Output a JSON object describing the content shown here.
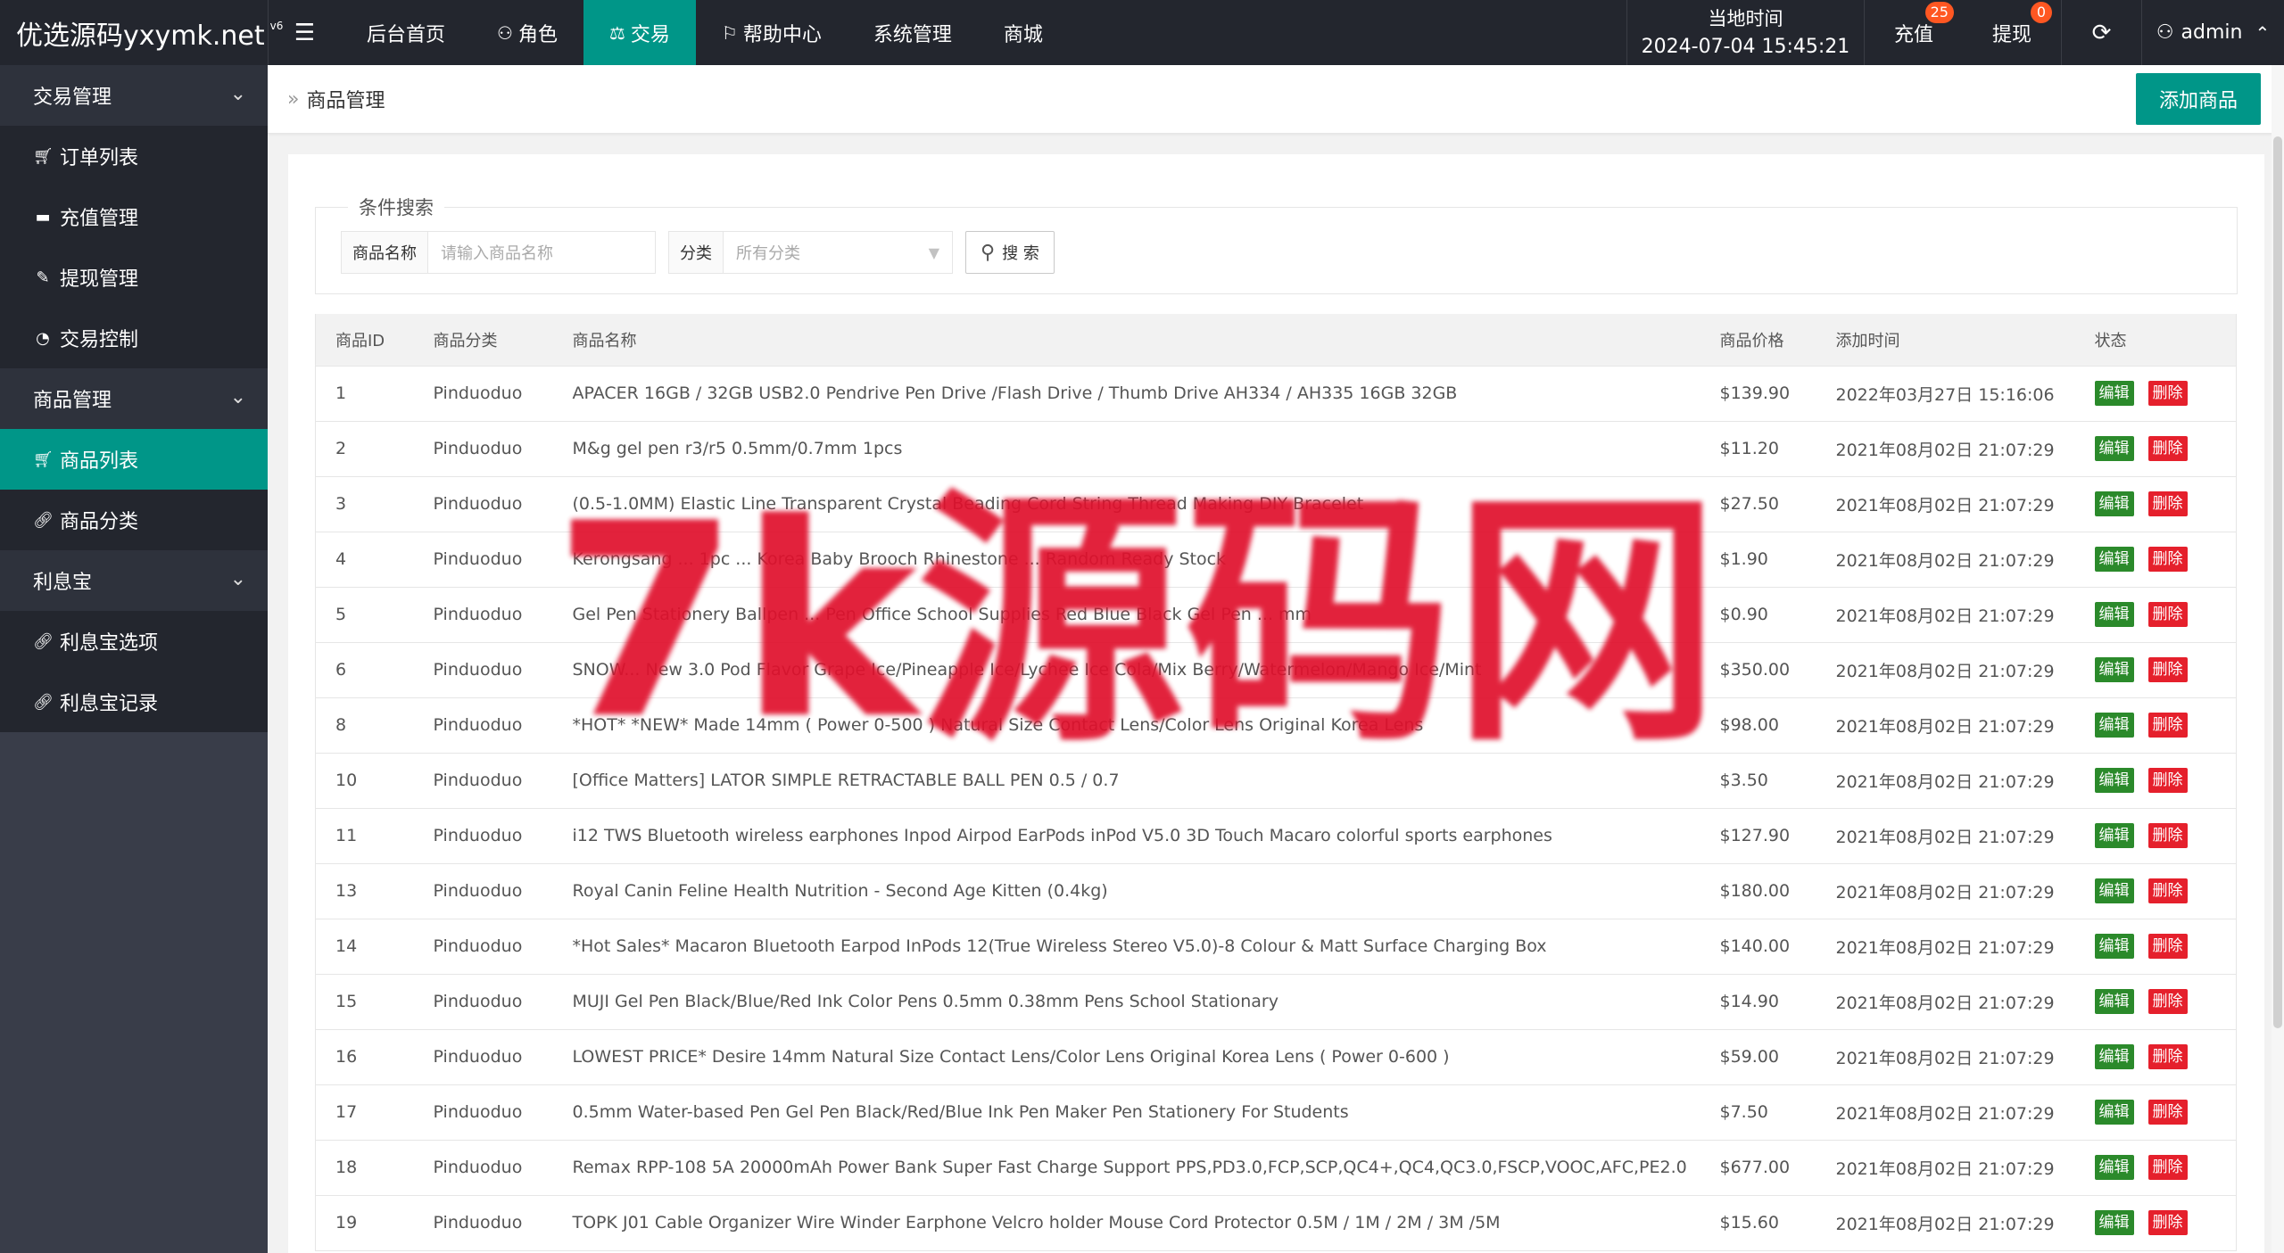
{
  "app": {
    "logo": "优选源码yxymk.net",
    "logo_version": "v6",
    "menu_icon": "hamburger-icon"
  },
  "nav": [
    {
      "label": "后台首页",
      "icon": ""
    },
    {
      "label": "角色",
      "icon": "user-icon"
    },
    {
      "label": "交易",
      "icon": "scale-icon",
      "active": true
    },
    {
      "label": "帮助中心",
      "icon": "flag-icon"
    },
    {
      "label": "系统管理",
      "icon": ""
    },
    {
      "label": "商城",
      "icon": ""
    }
  ],
  "header": {
    "clock_label": "当地时间",
    "clock_time": "2024-07-04 15:45:21",
    "recharge_label": "充值",
    "recharge_badge": "25",
    "withdraw_label": "提现",
    "withdraw_badge": "0",
    "user": "admin"
  },
  "sidebar": {
    "groups": [
      {
        "label": "交易管理",
        "items": [
          {
            "label": "订单列表",
            "icon": "cart-icon"
          },
          {
            "label": "充值管理",
            "icon": "card-icon"
          },
          {
            "label": "提现管理",
            "icon": "wrench-icon"
          },
          {
            "label": "交易控制",
            "icon": "gauge-icon"
          }
        ]
      },
      {
        "label": "商品管理",
        "items": [
          {
            "label": "商品列表",
            "icon": "cart-icon",
            "active": true
          },
          {
            "label": "商品分类",
            "icon": "link-icon"
          }
        ]
      },
      {
        "label": "利息宝",
        "items": [
          {
            "label": "利息宝选项",
            "icon": "link-icon"
          },
          {
            "label": "利息宝记录",
            "icon": "link-icon"
          }
        ]
      }
    ]
  },
  "page": {
    "breadcrumb": "商品管理",
    "add_button": "添加商品"
  },
  "search": {
    "legend": "条件搜索",
    "name_label": "商品名称",
    "name_placeholder": "请输入商品名称",
    "category_label": "分类",
    "category_value": "所有分类",
    "search_button": "搜 索"
  },
  "table": {
    "headers": [
      "商品ID",
      "商品分类",
      "商品名称",
      "商品价格",
      "添加时间",
      "状态"
    ],
    "edit_label": "编辑",
    "delete_label": "删除",
    "rows": [
      {
        "id": "1",
        "cat": "Pinduoduo",
        "name": "APACER 16GB / 32GB USB2.0 Pendrive Pen Drive /Flash Drive / Thumb Drive AH334 / AH335 16GB 32GB",
        "price": "$139.90",
        "time": "2022年03月27日 15:16:06"
      },
      {
        "id": "2",
        "cat": "Pinduoduo",
        "name": "M&g gel pen r3/r5 0.5mm/0.7mm 1pcs",
        "price": "$11.20",
        "time": "2021年08月02日 21:07:29"
      },
      {
        "id": "3",
        "cat": "Pinduoduo",
        "name": "(0.5-1.0MM) Elastic Line Transparent Crystal Beading Cord String Thread Making DIY Bracelet",
        "price": "$27.50",
        "time": "2021年08月02日 21:07:29"
      },
      {
        "id": "4",
        "cat": "Pinduoduo",
        "name": "Kerongsang ... 1pc ... Korea Baby Brooch Rhinestone ... Random Ready Stock",
        "price": "$1.90",
        "time": "2021年08月02日 21:07:29"
      },
      {
        "id": "5",
        "cat": "Pinduoduo",
        "name": "Gel Pen Stationery Ballpen ... Pen Office School Supplies Red Blue Black Gel Pen ... mm",
        "price": "$0.90",
        "time": "2021年08月02日 21:07:29"
      },
      {
        "id": "6",
        "cat": "Pinduoduo",
        "name": "SNOW... New 3.0 Pod Flavor Grape Ice/Pineapple Ice/Lychee Ice Cola/Mix Berry/Watermelon/Mango Ice/Mint",
        "price": "$350.00",
        "time": "2021年08月02日 21:07:29"
      },
      {
        "id": "8",
        "cat": "Pinduoduo",
        "name": "*HOT* *NEW* Made 14mm ( Power 0-500 ) Natural Size Contact Lens/Color Lens Original Korea Lens",
        "price": "$98.00",
        "time": "2021年08月02日 21:07:29"
      },
      {
        "id": "10",
        "cat": "Pinduoduo",
        "name": "[Office Matters] LATOR SIMPLE RETRACTABLE BALL PEN 0.5 / 0.7",
        "price": "$3.50",
        "time": "2021年08月02日 21:07:29"
      },
      {
        "id": "11",
        "cat": "Pinduoduo",
        "name": "i12 TWS Bluetooth wireless earphones Inpod Airpod EarPods inPod V5.0 3D Touch Macaro colorful sports earphones",
        "price": "$127.90",
        "time": "2021年08月02日 21:07:29"
      },
      {
        "id": "13",
        "cat": "Pinduoduo",
        "name": "Royal Canin Feline Health Nutrition - Second Age Kitten (0.4kg)",
        "price": "$180.00",
        "time": "2021年08月02日 21:07:29"
      },
      {
        "id": "14",
        "cat": "Pinduoduo",
        "name": "*Hot Sales* Macaron Bluetooth Earpod InPods 12(True Wireless Stereo V5.0)-8 Colour & Matt Surface Charging Box",
        "price": "$140.00",
        "time": "2021年08月02日 21:07:29"
      },
      {
        "id": "15",
        "cat": "Pinduoduo",
        "name": "MUJI Gel Pen Black/Blue/Red Ink Color Pens 0.5mm 0.38mm Pens School Stationary",
        "price": "$14.90",
        "time": "2021年08月02日 21:07:29"
      },
      {
        "id": "16",
        "cat": "Pinduoduo",
        "name": "LOWEST PRICE* Desire 14mm Natural Size Contact Lens/Color Lens Original Korea Lens ( Power 0-600 )",
        "price": "$59.00",
        "time": "2021年08月02日 21:07:29"
      },
      {
        "id": "17",
        "cat": "Pinduoduo",
        "name": "0.5mm Water-based Pen Gel Pen Black/Red/Blue Ink Pen Maker Pen Stationery For Students",
        "price": "$7.50",
        "time": "2021年08月02日 21:07:29"
      },
      {
        "id": "18",
        "cat": "Pinduoduo",
        "name": "Remax RPP-108 5A 20000mAh Power Bank Super Fast Charge Support PPS,PD3.0,FCP,SCP,QC4+,QC4,QC3.0,FSCP,VOOC,AFC,PE2.0",
        "price": "$677.00",
        "time": "2021年08月02日 21:07:29"
      },
      {
        "id": "19",
        "cat": "Pinduoduo",
        "name": "TOPK J01 Cable Organizer Wire Winder Earphone Velcro holder Mouse Cord Protector 0.5M / 1M / 2M / 3M /5M",
        "price": "$15.60",
        "time": "2021年08月02日 21:07:29"
      }
    ]
  },
  "watermark": "7k源码网",
  "colors": {
    "header_bg": "#23262e",
    "sidebar_bg": "#393d49",
    "accent": "#009688",
    "badge": "#ff5722",
    "edit": "#2b8a2b",
    "delete": "#e5202c",
    "watermark": "#e0102c"
  }
}
